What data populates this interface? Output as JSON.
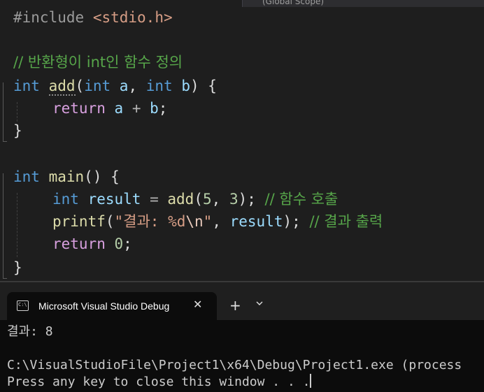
{
  "editor": {
    "scope_label": "(Global Scope)",
    "lines": {
      "include_directive": "#include",
      "include_file": "<stdio.h>",
      "comment1": "// 반환형이 int인 함수 정의",
      "add_kw_int": "int",
      "add_name": "add",
      "add_params_open": "(",
      "add_param1_type": "int",
      "add_param1_name": "a",
      "add_comma": ", ",
      "add_param2_type": "int",
      "add_param2_name": "b",
      "add_params_close": ") {",
      "return_kw": "return",
      "return_a": "a",
      "return_plus": " + ",
      "return_b": "b",
      "return_semi": ";",
      "close_brace1": "}",
      "main_kw_int": "int",
      "main_name": "main",
      "main_rest": "() {",
      "result_kw_int": "int",
      "result_var": "result",
      "result_eq": " = ",
      "result_call": "add",
      "result_open": "(",
      "result_arg1": "5",
      "result_comma": ", ",
      "result_arg2": "3",
      "result_close": ");",
      "result_comment": "// 함수 호출",
      "printf_name": "printf",
      "printf_open": "(",
      "printf_str1": "\"결과: %d",
      "printf_esc": "\\n",
      "printf_str2": "\"",
      "printf_comma": ", ",
      "printf_arg": "result",
      "printf_close": ");",
      "printf_comment": "// 결과 출력",
      "return0_kw": "return",
      "return0_val": "0",
      "return0_semi": ";",
      "close_brace2": "}"
    }
  },
  "terminal": {
    "tab_title": "Microsoft Visual Studio Debug",
    "tab_icon_text": "C:\\",
    "close_icon": "✕",
    "new_tab_icon": "+",
    "output": [
      "결과: 8",
      "",
      "C:\\VisualStudioFile\\Project1\\x64\\Debug\\Project1.exe (process",
      "Press any key to close this window . . ."
    ]
  },
  "colors": {
    "keyword": "#569cd6",
    "function": "#dcdcaa",
    "string": "#d69d85",
    "comment": "#57a64a",
    "identifier": "#9cdcfe",
    "number": "#b5cea8",
    "control_keyword": "#d8a0df"
  }
}
